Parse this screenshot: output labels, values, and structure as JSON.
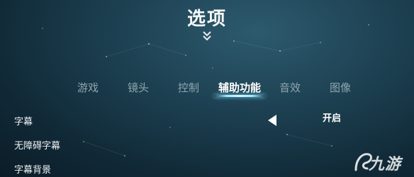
{
  "header": {
    "title": "选项"
  },
  "tabs": [
    {
      "label": "游戏",
      "active": false
    },
    {
      "label": "镜头",
      "active": false
    },
    {
      "label": "控制",
      "active": false
    },
    {
      "label": "辅助功能",
      "active": true
    },
    {
      "label": "音效",
      "active": false
    },
    {
      "label": "图像",
      "active": false
    }
  ],
  "settings": [
    {
      "label": "字幕",
      "value": "开启"
    },
    {
      "label": "无障碍字幕"
    },
    {
      "label": "字幕背景"
    }
  ],
  "watermark": {
    "text": "九游"
  },
  "icons": {
    "collapse": "double-chevron-down-icon",
    "prev": "arrow-left-icon",
    "logo": "jiuyou-logo-icon"
  },
  "colors": {
    "accent": "#9fe8ff",
    "tab_inactive": "#8fa6b1"
  }
}
